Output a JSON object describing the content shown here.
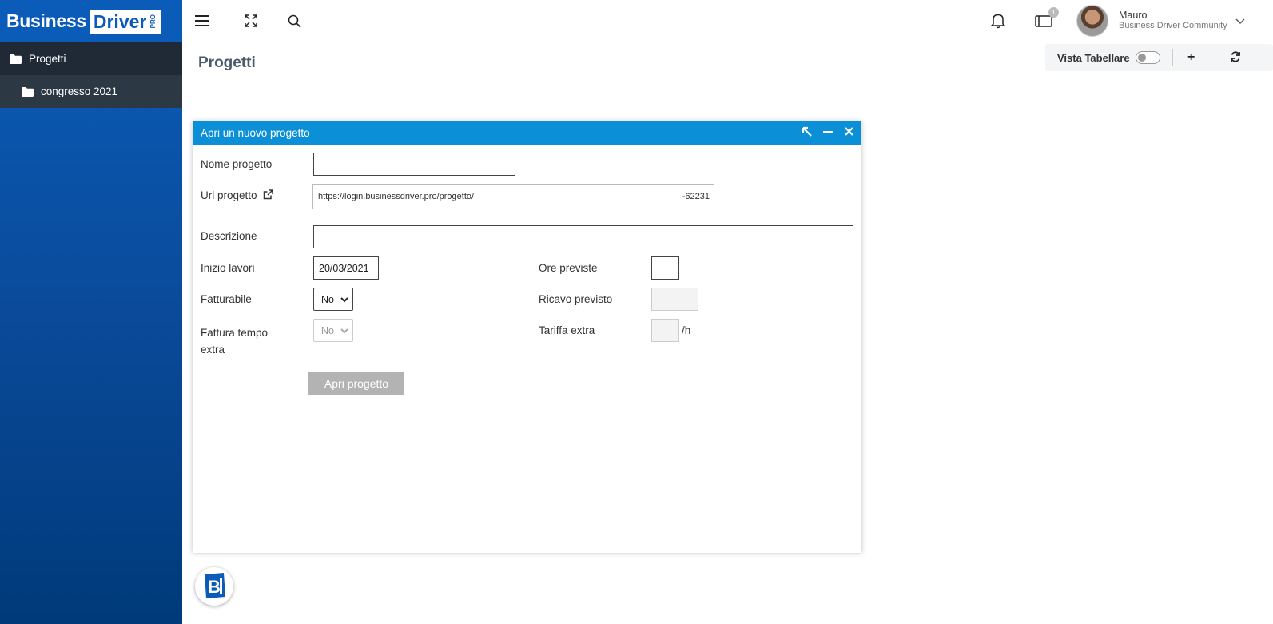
{
  "brand": {
    "word1": "Business",
    "word2": "Driver",
    "tag": "PRO"
  },
  "sidebar": {
    "items": [
      {
        "label": "Progetti",
        "icon": "folder-icon"
      },
      {
        "label": "congresso 2021",
        "icon": "folder-icon"
      }
    ]
  },
  "topbar": {
    "icons": [
      "menu-icon",
      "expand-icon",
      "search-icon",
      "bell-icon",
      "tablet-icon"
    ],
    "badge_count": "1",
    "user": {
      "name": "Mauro",
      "company": "Business Driver Community"
    }
  },
  "page": {
    "title": "Progetti",
    "toolbar": {
      "view_label": "Vista Tabellare",
      "toggle_on": false,
      "add": "+",
      "refresh": "refresh-icon"
    }
  },
  "dialog": {
    "title": "Apri un nuovo progetto",
    "fields": {
      "nome_label": "Nome progetto",
      "nome_value": "",
      "url_label": "Url progetto",
      "url_prefix": "https://login.businessdriver.pro/progetto/",
      "url_suffix": "-62231",
      "descrizione_label": "Descrizione",
      "descrizione_value": "",
      "inizio_label": "Inizio lavori",
      "inizio_value": "20/03/2021",
      "ore_label": "Ore previste",
      "ore_value": "",
      "fatturabile_label": "Fatturabile",
      "fatturabile_value": "No",
      "ricavo_label": "Ricavo previsto",
      "ricavo_value": "",
      "fattura_extra_label": "Fattura tempo extra",
      "fattura_extra_value": "No",
      "tariffa_label": "Tariffa extra",
      "tariffa_value": "",
      "tariffa_unit": "/h"
    },
    "submit": "Apri progetto"
  },
  "colors": {
    "brand_blue": "#0b5cb8",
    "dialog_header": "#0b8fd6",
    "sidebar_item": "#1f2a36"
  }
}
